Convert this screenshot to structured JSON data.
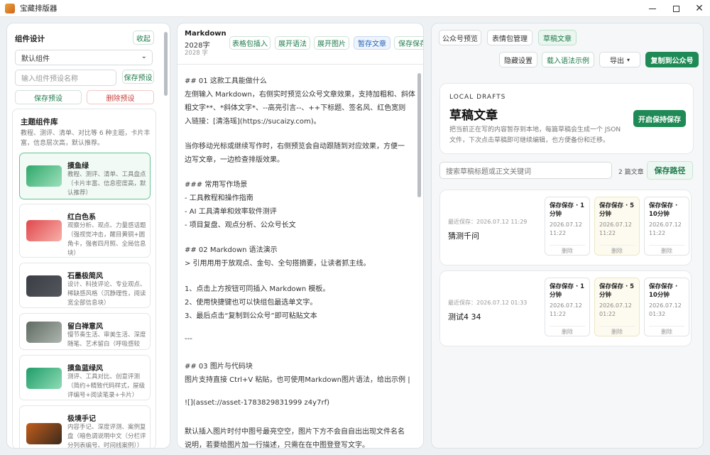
{
  "window": {
    "title": "宝藏排版器"
  },
  "left": {
    "title": "组件设计",
    "collapse_label": "收起",
    "preset_select": "默认组件",
    "preset_name_placeholder": "输入组件预设名称",
    "save_preset_label": "保存预设",
    "save_preset_btn": "保存预设",
    "delete_preset_btn": "删除预设",
    "library_title": "主题组件库",
    "library_desc": "教程、测评、清单、对比等 6 种主题，卡片丰富，信息层次高，默认推荐。",
    "themes": [
      {
        "name": "摸鱼绿",
        "desc": "教程、测评、清单、工具盘点（卡片丰富、信息密度高，默认推荐）",
        "color1": "#2ea86a",
        "color2": "#9fe0bd"
      },
      {
        "name": "红白色系",
        "desc": "观察分析、观点、力量感话题（强视觉冲击，醒目黄铜+圆角卡，强者四月照、全局信息块）",
        "color1": "#e0474c",
        "color2": "#f7b1aa"
      },
      {
        "name": "石墨极简风",
        "desc": "设计、科技评论、专业观点、稀缺感风格（沉静理性，阅读宽全部信息块）",
        "color1": "#3a3d44",
        "color2": "#54575e"
      },
      {
        "name": "留白禅意风",
        "desc": "慢节奏生活、审美生活、深度随笔、艺术留白（呼吸感较强）",
        "color1": "#5e6a63",
        "color2": "#aeb6ae"
      },
      {
        "name": "摸鱼蓝绿风",
        "desc": "测评、工具对比、创意评测（简约+精致代码样式，屋级评编号+阅读笔录+卡片）",
        "color1": "#1f9c68",
        "color2": "#8fdcb6"
      },
      {
        "name": "极境手记",
        "desc": "内容手记、深度评测、案例复盘（暗色调说明中文（分栏评分列表编号、时间线案例））",
        "color1": "#c25d1b",
        "color2": "#3b2a1c"
      }
    ]
  },
  "middle": {
    "title": "Markdown",
    "count": "2028字",
    "sub_count": "2028 字",
    "toolbar": [
      {
        "label": "表格包插入"
      },
      {
        "label": "展开语法"
      },
      {
        "label": "展开图片"
      },
      {
        "label": "暂存文章"
      },
      {
        "label": "保存保存"
      }
    ],
    "lines": [
      "## 01 这款工具能做什么",
      "左侧输入 Markdown，右侧实时预览公众号文章效果，支持加粗和、斜体、",
      "粗文字**、*斜体文字*、--高亮引言--、++下标题、签名风、红色宽则",
      "入链接：[清洛瑶](https://sucaizy.com)。",
      "",
      "当你移动光标或继续写作时，右侧预览会自动跟随到对应效果，方便一",
      "边写文章，一边检查排版效果。",
      "",
      "### 常用写作场景",
      "- 工具教程和操作指南",
      "- AI 工具清单和效率软件测评",
      "- 项目复盘、观点分析、公众号长文",
      "",
      "## 02 Markdown 语法演示",
      "> 引用用用于放观点、金句、全句搭摘要，让读者抓主线。",
      "",
      "1、点击上方按钮可同插入 Markdown 模板。",
      "2、使用快捷键也可以快组包最选单文字。",
      "3、最后点击“复制到公众号”即可粘贴文本",
      "",
      "---",
      "",
      "## 03 图片与代码块",
      "图片支持直接 Ctrl+V 粘贴，也可使用Markdown图片语法，给出示例 |",
      "",
      "![](asset://asset-1783829831999 z4y7rf)",
      "",
      "默认插入图片时付中图号最亮空空，图片下方不会自自出出现文件名名",
      "说明，若要给图片加一行描述，只需在在中图登登写文字。"
    ]
  },
  "right": {
    "tabs": [
      {
        "label": "公众号预览"
      },
      {
        "label": "表情包管理"
      },
      {
        "label": "草稿文章"
      }
    ],
    "actions": {
      "hide_settings": "隐藏设置",
      "load_demo": "载入语法示例",
      "export": "导出",
      "copy_to_wechat": "复制到公众号"
    },
    "hero": {
      "kicker": "LOCAL DRAFTS",
      "title": "草稿文章",
      "desc": "把当前正在写的内容暂存到本地，每篇草稿会生成一个 JSON 文件，下次点击草稿即可继续编辑，也方便备份和迁移。",
      "enable_btn": "开启保持保存"
    },
    "search_placeholder": "搜索草稿标题或正文关键词",
    "article_count": "2 篇文章",
    "save_path_btn": "保存路径",
    "drafts": [
      {
        "saved_at": "最近保存：2026.07.12 11:29",
        "title": "猜测千问",
        "slots": [
          {
            "label": "保存保存 · 1 分钟",
            "date": "2026.07.12",
            "time": "11:22",
            "delete": "删除"
          },
          {
            "label": "保存保存 · 5 分钟",
            "date": "2026.07.12",
            "time": "11:22",
            "delete": "删除"
          },
          {
            "label": "保存保存 · 10分钟",
            "date": "2026.07.12",
            "time": "11:22",
            "delete": "删除"
          }
        ]
      },
      {
        "saved_at": "最近保存：2026.07.12 01:33",
        "title": "测试4 34",
        "slots": [
          {
            "label": "保存保存 · 1 分钟",
            "date": "2026.07.12",
            "time": "11:22",
            "delete": "删除"
          },
          {
            "label": "保存保存 · 5 分钟",
            "date": "2026.07.12",
            "time": "01:22",
            "delete": "删除"
          },
          {
            "label": "保存保存 · 10分钟",
            "date": "2026.07.12",
            "time": "01:32",
            "delete": "删除"
          }
        ]
      }
    ]
  }
}
